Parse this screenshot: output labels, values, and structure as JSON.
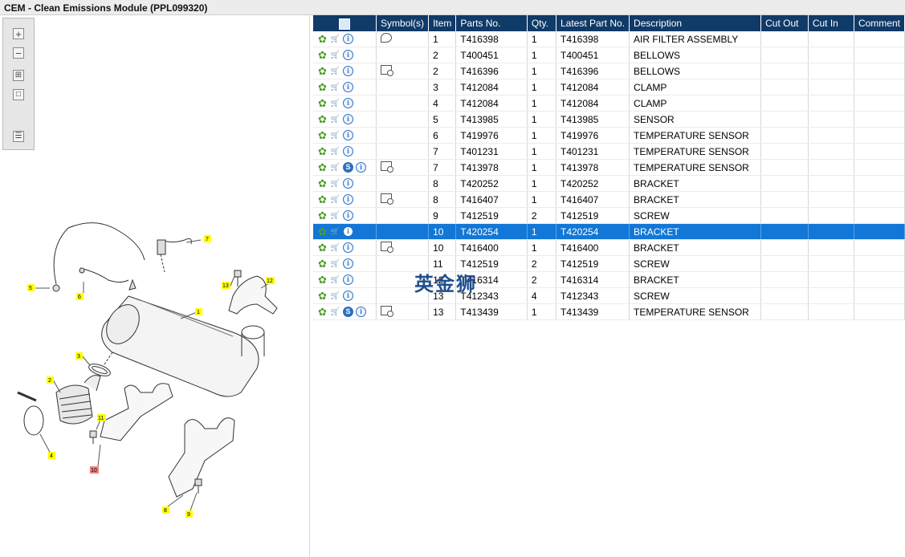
{
  "window": {
    "title": "CEM - Clean Emissions Module (PPL099320)"
  },
  "toolbox": {
    "zoom_in_icon": "plus-icon",
    "zoom_out_icon": "minus-icon",
    "fit_icon": "grid-icon",
    "actual_icon": "square-icon",
    "list_icon": "list-arrow-icon"
  },
  "diagram": {
    "callouts": [
      "1",
      "2",
      "3",
      "4",
      "5",
      "6",
      "7",
      "8",
      "9",
      "10",
      "11",
      "12",
      "13"
    ],
    "callout_color": "#ffff00",
    "highlight_color": "#f08080"
  },
  "table": {
    "headers": {
      "icons": "",
      "symbols": "Symbol(s)",
      "item": "Item",
      "part_no": "Parts No.",
      "qty": "Qty.",
      "latest": "Latest Part No.",
      "description": "Description",
      "cut_out": "Cut Out",
      "cut_in": "Cut In",
      "comment": "Comment"
    },
    "header_color": "#103a68",
    "selected_color": "#1277d6",
    "rows": [
      {
        "item": "1",
        "part_no": "T416398",
        "qty": "1",
        "latest": "T416398",
        "description": "AIR FILTER ASSEMBLY",
        "s_icon": false,
        "symbol": "note"
      },
      {
        "item": "2",
        "part_no": "T400451",
        "qty": "1",
        "latest": "T400451",
        "description": "BELLOWS",
        "s_icon": false,
        "symbol": ""
      },
      {
        "item": "2",
        "part_no": "T416396",
        "qty": "1",
        "latest": "T416396",
        "description": "BELLOWS",
        "s_icon": false,
        "symbol": "view"
      },
      {
        "item": "3",
        "part_no": "T412084",
        "qty": "1",
        "latest": "T412084",
        "description": "CLAMP",
        "s_icon": false,
        "symbol": ""
      },
      {
        "item": "4",
        "part_no": "T412084",
        "qty": "1",
        "latest": "T412084",
        "description": "CLAMP",
        "s_icon": false,
        "symbol": ""
      },
      {
        "item": "5",
        "part_no": "T413985",
        "qty": "1",
        "latest": "T413985",
        "description": "SENSOR",
        "s_icon": false,
        "symbol": ""
      },
      {
        "item": "6",
        "part_no": "T419976",
        "qty": "1",
        "latest": "T419976",
        "description": "TEMPERATURE SENSOR",
        "s_icon": false,
        "symbol": ""
      },
      {
        "item": "7",
        "part_no": "T401231",
        "qty": "1",
        "latest": "T401231",
        "description": "TEMPERATURE SENSOR",
        "s_icon": false,
        "symbol": ""
      },
      {
        "item": "7",
        "part_no": "T413978",
        "qty": "1",
        "latest": "T413978",
        "description": "TEMPERATURE SENSOR",
        "s_icon": true,
        "symbol": "view"
      },
      {
        "item": "8",
        "part_no": "T420252",
        "qty": "1",
        "latest": "T420252",
        "description": "BRACKET",
        "s_icon": false,
        "symbol": ""
      },
      {
        "item": "8",
        "part_no": "T416407",
        "qty": "1",
        "latest": "T416407",
        "description": "BRACKET",
        "s_icon": false,
        "symbol": "view"
      },
      {
        "item": "9",
        "part_no": "T412519",
        "qty": "2",
        "latest": "T412519",
        "description": "SCREW",
        "s_icon": false,
        "symbol": ""
      },
      {
        "item": "10",
        "part_no": "T420254",
        "qty": "1",
        "latest": "T420254",
        "description": "BRACKET",
        "s_icon": false,
        "symbol": "",
        "selected": true
      },
      {
        "item": "10",
        "part_no": "T416400",
        "qty": "1",
        "latest": "T416400",
        "description": "BRACKET",
        "s_icon": false,
        "symbol": "view"
      },
      {
        "item": "11",
        "part_no": "T412519",
        "qty": "2",
        "latest": "T412519",
        "description": "SCREW",
        "s_icon": false,
        "symbol": ""
      },
      {
        "item": "12",
        "part_no": "T416314",
        "qty": "2",
        "latest": "T416314",
        "description": "BRACKET",
        "s_icon": false,
        "symbol": ""
      },
      {
        "item": "13",
        "part_no": "T412343",
        "qty": "4",
        "latest": "T412343",
        "description": "SCREW",
        "s_icon": false,
        "symbol": ""
      },
      {
        "item": "13",
        "part_no": "T413439",
        "qty": "1",
        "latest": "T413439",
        "description": "TEMPERATURE SENSOR",
        "s_icon": true,
        "symbol": "view"
      }
    ]
  },
  "watermark": "英金狮"
}
